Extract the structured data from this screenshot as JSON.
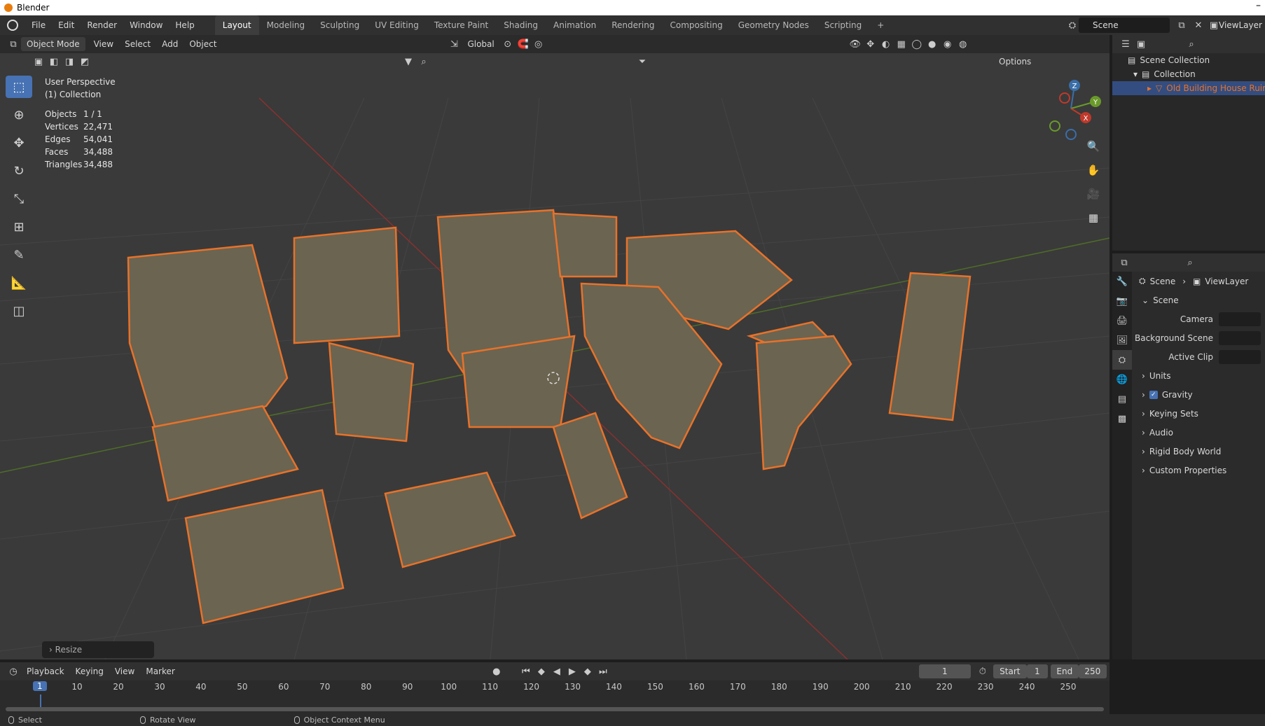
{
  "titlebar": {
    "title": "Blender"
  },
  "menu": [
    "File",
    "Edit",
    "Render",
    "Window",
    "Help"
  ],
  "workspaces": [
    "Layout",
    "Modeling",
    "Sculpting",
    "UV Editing",
    "Texture Paint",
    "Shading",
    "Animation",
    "Rendering",
    "Compositing",
    "Geometry Nodes",
    "Scripting"
  ],
  "active_workspace": "Layout",
  "scene_name": "Scene",
  "view_layer": "ViewLayer",
  "viewport_header": {
    "mode": "Object Mode",
    "view": "View",
    "select": "Select",
    "add": "Add",
    "object": "Object",
    "transform_orientation": "Global",
    "options": "Options"
  },
  "overlay": {
    "view_name": "User Perspective",
    "collection": "(1) Collection",
    "stats": [
      {
        "key": "Objects",
        "value": "1 / 1"
      },
      {
        "key": "Vertices",
        "value": "22,471"
      },
      {
        "key": "Edges",
        "value": "54,041"
      },
      {
        "key": "Faces",
        "value": "34,488"
      },
      {
        "key": "Triangles",
        "value": "34,488"
      }
    ]
  },
  "gizmo_axes": {
    "x": "X",
    "y": "Y",
    "z": "Z"
  },
  "last_operator": "Resize",
  "outliner": {
    "scene_collection": "Scene Collection",
    "collection": "Collection",
    "object": "Old Building House Ruins P"
  },
  "properties": {
    "breadcrumb_scene": "Scene",
    "breadcrumb_viewlayer": "ViewLayer",
    "panel_title": "Scene",
    "fields": [
      {
        "label": "Camera"
      },
      {
        "label": "Background Scene"
      },
      {
        "label": "Active Clip"
      }
    ],
    "subpanels": [
      "Units",
      "Gravity",
      "Keying Sets",
      "Audio",
      "Rigid Body World",
      "Custom Properties"
    ],
    "gravity_checked": true
  },
  "timeline": {
    "playback": "Playback",
    "keying": "Keying",
    "view": "View",
    "marker": "Marker",
    "current_frame": "1",
    "start_label": "Start",
    "start_value": "1",
    "end_label": "End",
    "end_value": "250",
    "frame_labels": [
      "1",
      "10",
      "20",
      "30",
      "40",
      "50",
      "60",
      "70",
      "80",
      "90",
      "100",
      "110",
      "120",
      "130",
      "140",
      "150",
      "160",
      "170",
      "180",
      "190",
      "200",
      "210",
      "220",
      "230",
      "240",
      "250"
    ]
  },
  "statusbar": [
    "Select",
    "Rotate View",
    "Object Context Menu"
  ],
  "colors": {
    "accent": "#4772b3",
    "selection_outline": "#e8722a",
    "axis_x": "#c0392b",
    "axis_y": "#6a9a2a"
  }
}
